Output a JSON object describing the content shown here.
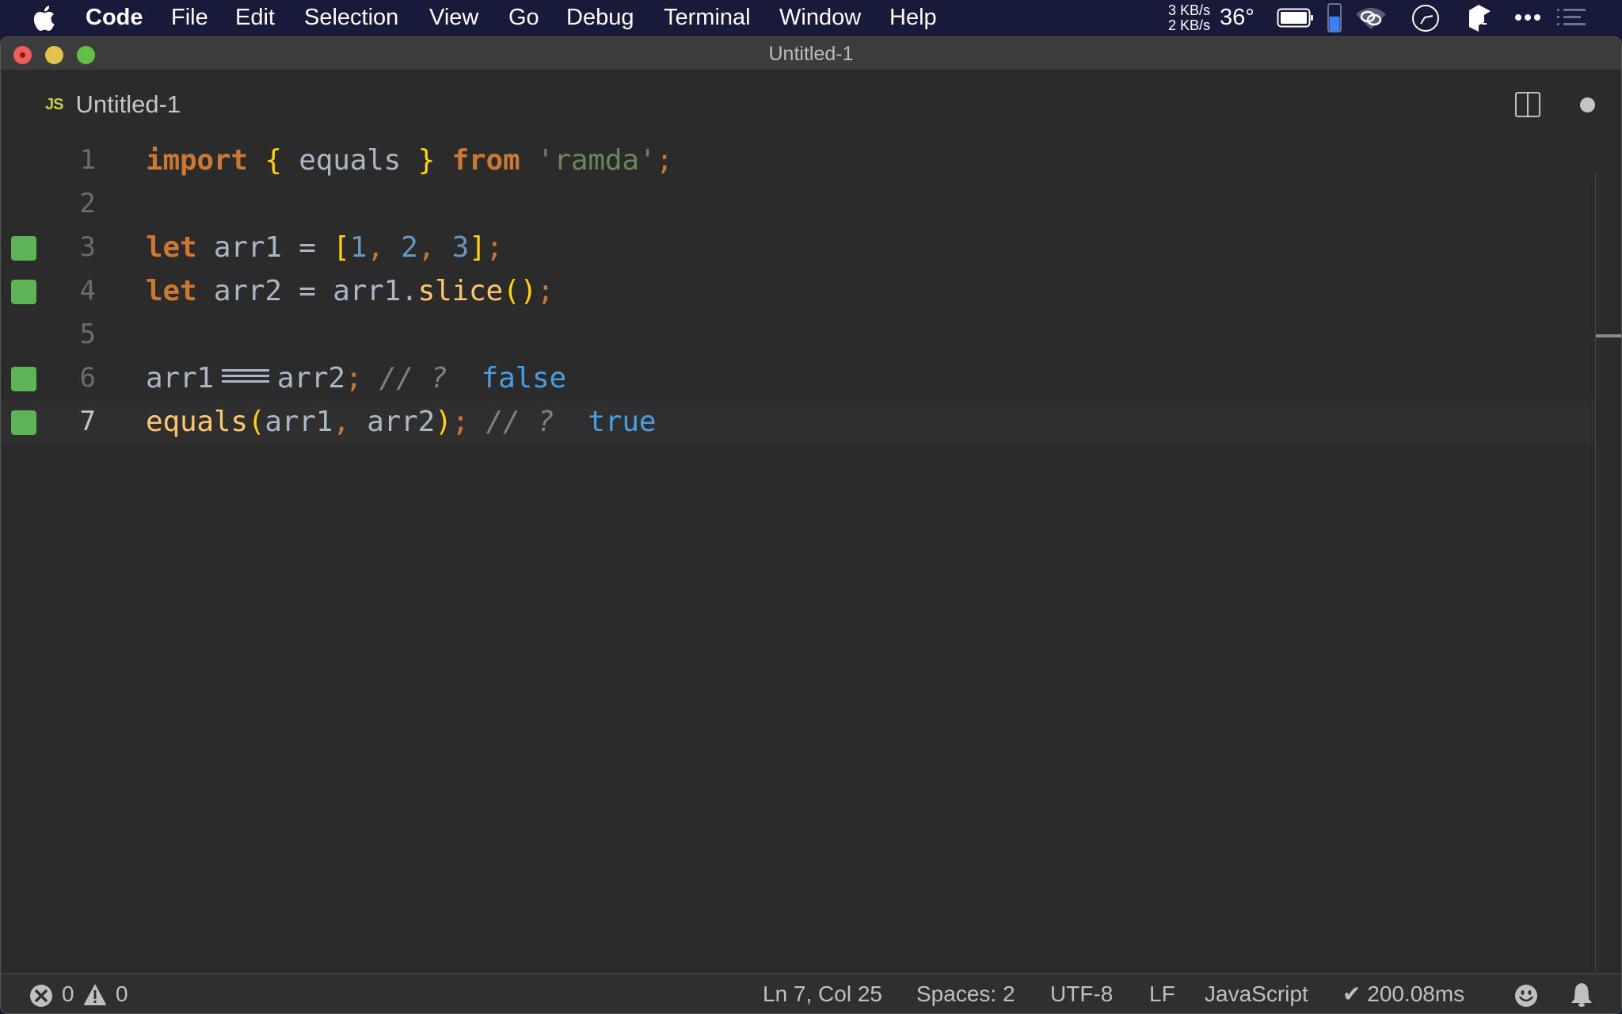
{
  "menubar": {
    "app_name": "Code",
    "items": [
      "File",
      "Edit",
      "Selection",
      "View",
      "Go",
      "Debug",
      "Terminal",
      "Window",
      "Help"
    ],
    "tray": {
      "net_up": "3 KB/s",
      "net_down": "2 KB/s",
      "temperature": "36°",
      "icons": [
        "battery-icon",
        "memory-gauge-icon",
        "creative-cloud-icon",
        "clock-icon",
        "dropbox-icon",
        "more-icon",
        "control-center-list-icon"
      ],
      "memory_fill_fraction": 0.55,
      "accent_blue": "#3b82f6"
    }
  },
  "window": {
    "title": "Untitled-1"
  },
  "tab": {
    "icon_text": "JS",
    "label": "Untitled-1",
    "dirty": true
  },
  "editor": {
    "current_line": 7,
    "lines": [
      {
        "number": "1",
        "marker": false
      },
      {
        "number": "2",
        "marker": false
      },
      {
        "number": "3",
        "marker": true
      },
      {
        "number": "4",
        "marker": true
      },
      {
        "number": "5",
        "marker": false
      },
      {
        "number": "6",
        "marker": true
      },
      {
        "number": "7",
        "marker": true
      }
    ],
    "tokens": {
      "l1": [
        "import",
        " ",
        "{",
        " equals ",
        "}",
        " ",
        "from",
        " ",
        "'ramda'",
        ";"
      ],
      "l3": [
        "let",
        " arr1 = ",
        "[",
        "1",
        ", ",
        "2",
        ", ",
        "3",
        "]",
        ";"
      ],
      "l4": [
        "let",
        " arr2 = arr1.",
        "slice",
        "(",
        ")",
        ";"
      ],
      "l6": [
        "arr1",
        "arr2",
        ";",
        " // ?  ",
        "false"
      ],
      "l7": [
        "equals",
        "(",
        "arr1",
        ", ",
        "arr2",
        ")",
        ";",
        " // ?  ",
        "true"
      ]
    },
    "marker_color": "#5db356"
  },
  "statusbar": {
    "errors": "0",
    "warnings": "0",
    "cursor": "Ln 7, Col 25",
    "indent": "Spaces: 2",
    "encoding": "UTF-8",
    "eol": "LF",
    "language": "JavaScript",
    "timing": "✔ 200.08ms"
  }
}
